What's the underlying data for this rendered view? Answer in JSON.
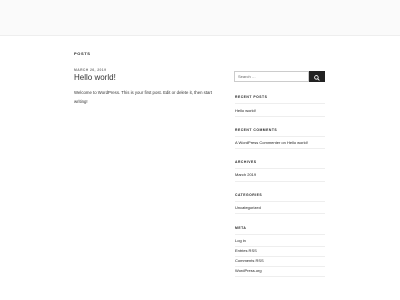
{
  "header": {
    "section_title": "POSTS"
  },
  "post": {
    "date": "MARCH 26, 2019",
    "title": "Hello world!",
    "body": "Welcome to WordPress. This is your first post. Edit or delete it, then start writing!"
  },
  "sidebar": {
    "search": {
      "placeholder": "Search …",
      "button_icon": "search-icon"
    },
    "recent_posts": {
      "title": "RECENT POSTS",
      "items": [
        "Hello world!"
      ]
    },
    "recent_comments": {
      "title": "RECENT COMMENTS",
      "items": [
        "A WordPress Commenter on Hello world!"
      ]
    },
    "archives": {
      "title": "ARCHIVES",
      "items": [
        "March 2019"
      ]
    },
    "categories": {
      "title": "CATEGORIES",
      "items": [
        "Uncategorized"
      ]
    },
    "meta": {
      "title": "META",
      "items": [
        "Log in",
        "Entries RSS",
        "Comments RSS",
        "WordPress.org"
      ]
    }
  },
  "colors": {
    "text": "#333333",
    "heading": "#222222",
    "muted": "#767676",
    "rule": "#eeeeee",
    "button": "#222222"
  }
}
